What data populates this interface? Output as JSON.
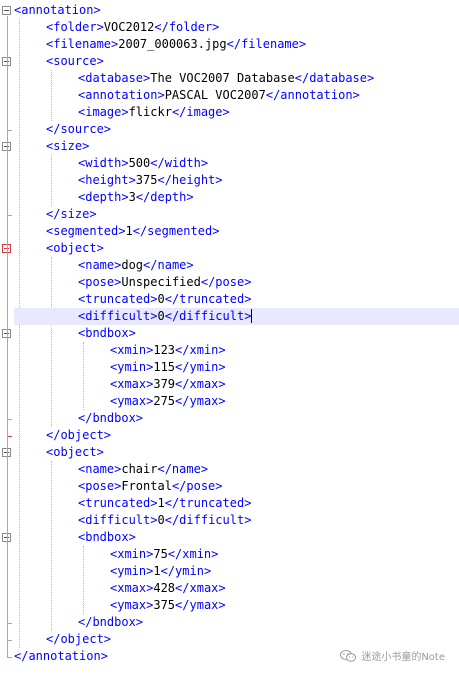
{
  "editor": {
    "lines": [
      {
        "indent": 0,
        "open": "<annotation>"
      },
      {
        "indent": 1,
        "open": "<folder>",
        "value": "VOC2012",
        "close": "</folder>"
      },
      {
        "indent": 1,
        "open": "<filename>",
        "value": "2007_000063.jpg",
        "close": "</filename>"
      },
      {
        "indent": 1,
        "open": "<source>"
      },
      {
        "indent": 2,
        "open": "<database>",
        "value": "The VOC2007 Database",
        "close": "</database>"
      },
      {
        "indent": 2,
        "open": "<annotation>",
        "value": "PASCAL VOC2007",
        "close": "</annotation>"
      },
      {
        "indent": 2,
        "open": "<image>",
        "value": "flickr",
        "close": "</image>"
      },
      {
        "indent": 1,
        "close": "</source>"
      },
      {
        "indent": 1,
        "open": "<size>"
      },
      {
        "indent": 2,
        "open": "<width>",
        "value": "500",
        "close": "</width>"
      },
      {
        "indent": 2,
        "open": "<height>",
        "value": "375",
        "close": "</height>"
      },
      {
        "indent": 2,
        "open": "<depth>",
        "value": "3",
        "close": "</depth>"
      },
      {
        "indent": 1,
        "close": "</size>"
      },
      {
        "indent": 1,
        "open": "<segmented>",
        "value": "1",
        "close": "</segmented>"
      },
      {
        "indent": 1,
        "open": "<object>"
      },
      {
        "indent": 2,
        "open": "<name>",
        "value": "dog",
        "close": "</name>"
      },
      {
        "indent": 2,
        "open": "<pose>",
        "value": "Unspecified",
        "close": "</pose>"
      },
      {
        "indent": 2,
        "open": "<truncated>",
        "value": "0",
        "close": "</truncated>"
      },
      {
        "indent": 2,
        "open": "<difficult>",
        "value": "0",
        "close": "</difficult>",
        "current": true
      },
      {
        "indent": 2,
        "open": "<bndbox>"
      },
      {
        "indent": 3,
        "open": "<xmin>",
        "value": "123",
        "close": "</xmin>"
      },
      {
        "indent": 3,
        "open": "<ymin>",
        "value": "115",
        "close": "</ymin>"
      },
      {
        "indent": 3,
        "open": "<xmax>",
        "value": "379",
        "close": "</xmax>"
      },
      {
        "indent": 3,
        "open": "<ymax>",
        "value": "275",
        "close": "</ymax>"
      },
      {
        "indent": 2,
        "close": "</bndbox>"
      },
      {
        "indent": 1,
        "close": "</object>"
      },
      {
        "indent": 1,
        "open": "<object>"
      },
      {
        "indent": 2,
        "open": "<name>",
        "value": "chair",
        "close": "</name>"
      },
      {
        "indent": 2,
        "open": "<pose>",
        "value": "Frontal",
        "close": "</pose>"
      },
      {
        "indent": 2,
        "open": "<truncated>",
        "value": "1",
        "close": "</truncated>"
      },
      {
        "indent": 2,
        "open": "<difficult>",
        "value": "0",
        "close": "</difficult>"
      },
      {
        "indent": 2,
        "open": "<bndbox>"
      },
      {
        "indent": 3,
        "open": "<xmin>",
        "value": "75",
        "close": "</xmin>"
      },
      {
        "indent": 3,
        "open": "<ymin>",
        "value": "1",
        "close": "</ymin>"
      },
      {
        "indent": 3,
        "open": "<xmax>",
        "value": "428",
        "close": "</xmax>"
      },
      {
        "indent": 3,
        "open": "<ymax>",
        "value": "375",
        "close": "</ymax>"
      },
      {
        "indent": 2,
        "close": "</bndbox>"
      },
      {
        "indent": 1,
        "close": "</object>"
      },
      {
        "indent": 0,
        "close": "</annotation>"
      }
    ]
  },
  "watermark": {
    "text": "迷途小书童的Note",
    "icon": "wechat-icon"
  },
  "colors": {
    "tag": "#0000ff",
    "value": "#000000",
    "current_line": "#e8e8ff",
    "fold_active": "#d23c3c",
    "fold": "#a8a8a8"
  }
}
